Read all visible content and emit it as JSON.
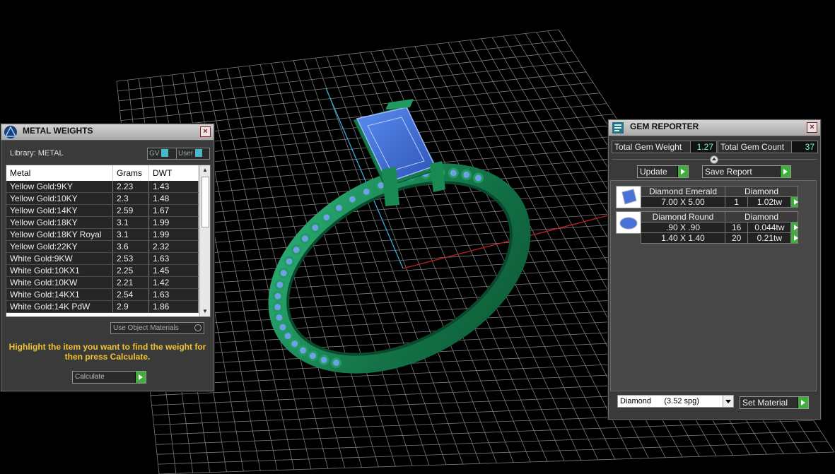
{
  "metal_weights": {
    "title": "METAL WEIGHTS",
    "close": "×",
    "library_label": "Library: METAL",
    "gv_label": "GV",
    "user_label": "User",
    "columns": [
      "Metal",
      "Grams",
      "DWT"
    ],
    "rows": [
      {
        "metal": "Yellow Gold:9KY",
        "grams": "2.23",
        "dwt": "1.43"
      },
      {
        "metal": "Yellow Gold:10KY",
        "grams": "2.3",
        "dwt": "1.48"
      },
      {
        "metal": "Yellow Gold:14KY",
        "grams": "2.59",
        "dwt": "1.67"
      },
      {
        "metal": "Yellow Gold:18KY",
        "grams": "3.1",
        "dwt": "1.99"
      },
      {
        "metal": "Yellow Gold:18KY Royal",
        "grams": "3.1",
        "dwt": "1.99"
      },
      {
        "metal": "Yellow Gold:22KY",
        "grams": "3.6",
        "dwt": "2.32"
      },
      {
        "metal": "White Gold:9KW",
        "grams": "2.53",
        "dwt": "1.63"
      },
      {
        "metal": "White Gold:10KX1",
        "grams": "2.25",
        "dwt": "1.45"
      },
      {
        "metal": "White Gold:10KW",
        "grams": "2.21",
        "dwt": "1.42"
      },
      {
        "metal": "White Gold:14KX1",
        "grams": "2.54",
        "dwt": "1.63"
      },
      {
        "metal": "White Gold:14K PdW",
        "grams": "2.9",
        "dwt": "1.86"
      }
    ],
    "use_object_materials": "Use Object Materials",
    "instruction": "Highlight the item you want to find the weight for then press Calculate.",
    "calculate_label": "Calculate"
  },
  "gem_reporter": {
    "title": "GEM REPORTER",
    "close": "×",
    "total_gem_weight_label": "Total Gem Weight",
    "total_gem_weight": "1.27",
    "total_gem_count_label": "Total Gem Count",
    "total_gem_count": "37",
    "update_label": "Update",
    "save_report_label": "Save Report",
    "groups": [
      {
        "shape": "Diamond Emerald",
        "material": "Diamond",
        "rows": [
          {
            "size": "7.00 X 5.00",
            "count": "1",
            "weight": "1.02tw"
          }
        ]
      },
      {
        "shape": "Diamond Round",
        "material": "Diamond",
        "rows": [
          {
            "size": ".90 X .90",
            "count": "16",
            "weight": "0.044tw"
          },
          {
            "size": "1.40 X 1.40",
            "count": "20",
            "weight": "0.21tw"
          }
        ]
      }
    ],
    "material_select": "Diamond      (3.52 spg)",
    "set_material_label": "Set Material"
  },
  "colors": {
    "ring_green": "#1f8a5a",
    "gem_blue": "#3f6fd8",
    "accent_green": "#3fae3a",
    "instruction_yellow": "#f2c230"
  }
}
